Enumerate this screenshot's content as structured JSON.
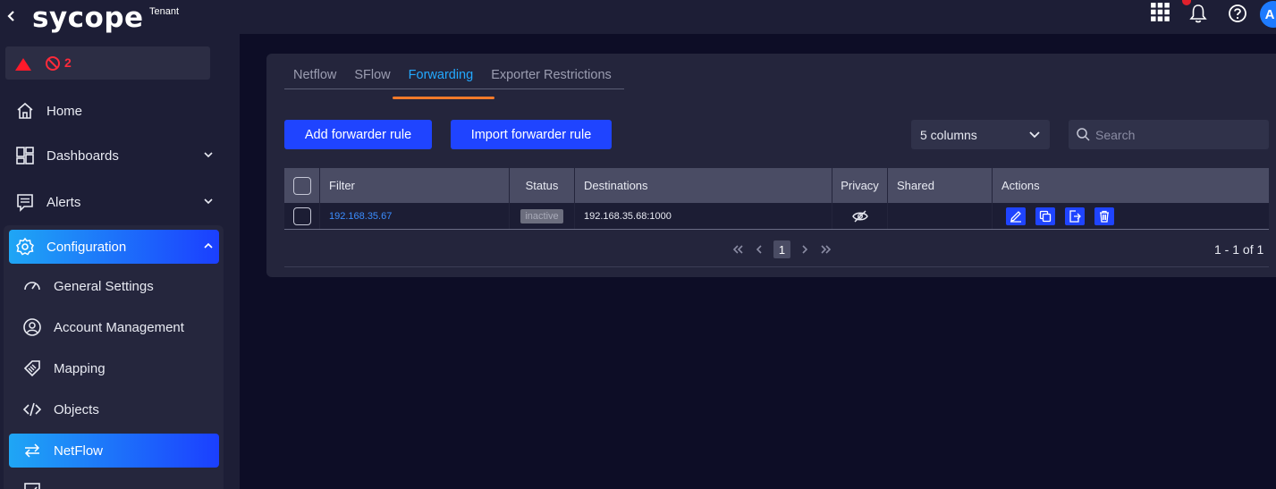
{
  "brand": {
    "logo": "sycope",
    "tenant": "Tenant"
  },
  "alerts": {
    "count": "2"
  },
  "sidebar": {
    "items": [
      {
        "label": "Home",
        "icon": "home-icon"
      },
      {
        "label": "Dashboards",
        "icon": "dashboard-icon"
      },
      {
        "label": "Alerts",
        "icon": "alerts-icon"
      },
      {
        "label": "Configuration",
        "icon": "gear-icon"
      }
    ],
    "config_items": [
      {
        "label": "General Settings",
        "icon": "gauge-icon"
      },
      {
        "label": "Account Management",
        "icon": "user-icon"
      },
      {
        "label": "Mapping",
        "icon": "tag-icon"
      },
      {
        "label": "Objects",
        "icon": "code-icon"
      },
      {
        "label": "NetFlow",
        "icon": "arrows-icon"
      }
    ]
  },
  "topbar": {
    "avatar": "A"
  },
  "tabs": [
    "Netflow",
    "SFlow",
    "Forwarding",
    "Exporter Restrictions"
  ],
  "active_tab": "Forwarding",
  "toolbar": {
    "add_label": "Add forwarder rule",
    "import_label": "Import forwarder rule",
    "columns_select": "5 columns",
    "search_placeholder": "Search"
  },
  "table": {
    "headers": [
      "Filter",
      "Status",
      "Destinations",
      "Privacy",
      "Shared",
      "Actions"
    ],
    "rows": [
      {
        "filter": "192.168.35.67",
        "status": "inactive",
        "destinations": "192.168.35.68:1000",
        "privacy": "eye-off-icon",
        "shared": ""
      }
    ]
  },
  "pagination": {
    "current": "1",
    "info": "1 - 1 of 1"
  },
  "colors": {
    "accent": "#1f44ff",
    "active_tab": "#23a9ff",
    "tab_underline": "#f47a2a",
    "alert": "#ff2a3a"
  }
}
